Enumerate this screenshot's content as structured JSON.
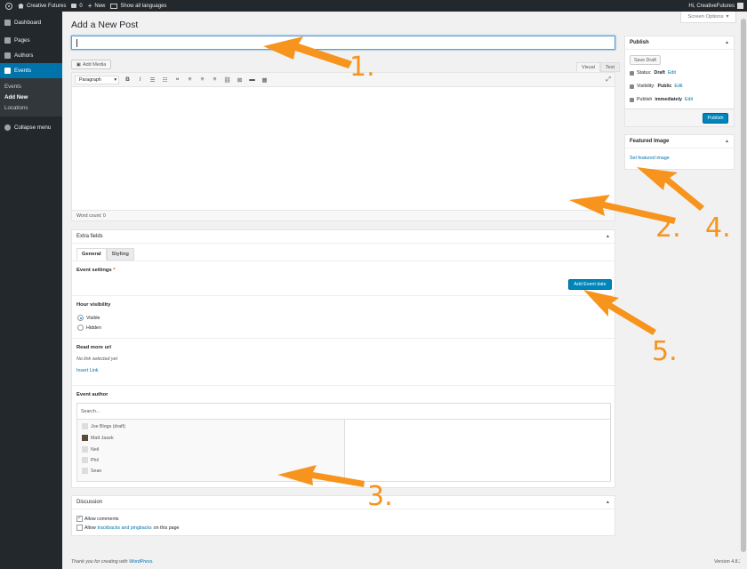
{
  "adminbar": {
    "site_name": "Creative Futures",
    "comments": "0",
    "new_label": "New",
    "languages": "Show all languages",
    "greeting": "Hi, CreativeFutures"
  },
  "sidebar": {
    "items": [
      {
        "label": "Dashboard",
        "icon": "dashboard-icon"
      },
      {
        "label": "Pages",
        "icon": "pages-icon"
      },
      {
        "label": "Authors",
        "icon": "authors-icon"
      },
      {
        "label": "Events",
        "icon": "events-icon"
      }
    ],
    "submenu": [
      "Events",
      "Add New",
      "Locations"
    ],
    "collapse": "Collapse menu"
  },
  "screen_options": "Screen Options",
  "page_title": "Add a New Post",
  "editor": {
    "add_media": "Add Media",
    "tab_visual": "Visual",
    "tab_text": "Text",
    "format": "Paragraph",
    "word_count": "Word count: 0"
  },
  "publish": {
    "title": "Publish",
    "save_draft": "Save Draft",
    "status_label": "Status:",
    "status_value": "Draft",
    "visibility_label": "Visibility:",
    "visibility_value": "Public",
    "publish_label": "Publish",
    "publish_value": "immediately",
    "edit": "Edit",
    "publish_button": "Publish"
  },
  "featured": {
    "title": "Featured Image",
    "link": "Set featured image"
  },
  "extra_fields": {
    "title": "Extra fields",
    "tab_general": "General",
    "tab_styling": "Styling",
    "event_settings": "Event settings",
    "add_event_date": "Add Event date",
    "hour_visibility": "Hour visibility",
    "visible": "Visible",
    "hidden": "Hidden",
    "read_more": "Read more url",
    "no_link": "No link selected yet",
    "insert_link": "Insert Link",
    "event_author": "Event author",
    "search_placeholder": "Search...",
    "authors": [
      "Joe Blogs (draft)",
      "Matt Jasek",
      "Neil",
      "Phil",
      "Sean"
    ]
  },
  "discussion": {
    "title": "Discussion",
    "allow_comments": "Allow comments",
    "allow_prefix": "Allow",
    "trackbacks": "trackbacks and pingbacks",
    "on_this_page": "on this page"
  },
  "footer": {
    "thanks": "Thank you for creating with",
    "wordpress": "WordPress.",
    "version": "Version 4.8.2"
  },
  "annotations": [
    "1.",
    "2.",
    "3.",
    "4.",
    "5."
  ],
  "colors": {
    "accent": "#0085ba",
    "annotation": "#f7941d",
    "sidebar": "#23282d"
  }
}
